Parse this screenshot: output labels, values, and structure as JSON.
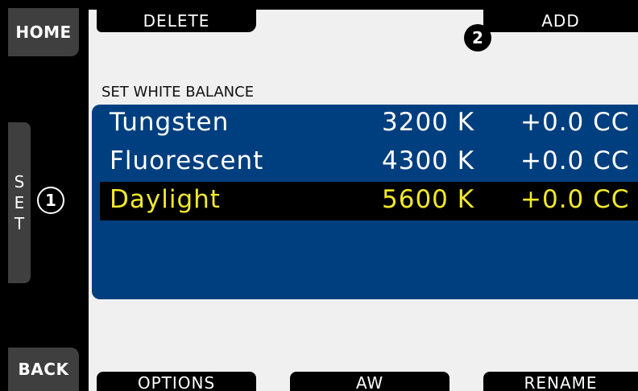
{
  "softkeys": {
    "home": "HOME",
    "back": "BACK",
    "set_letters": [
      "S",
      "E",
      "T"
    ],
    "delete": "DELETE",
    "add": "ADD",
    "options": "OPTIONS",
    "aw": "AW",
    "rename": "RENAME"
  },
  "callouts": {
    "one": "1",
    "two": "2"
  },
  "section_title": "SET WHITE BALANCE",
  "white_balance_list": [
    {
      "name": "Tungsten",
      "temperature": "3200 K",
      "cc": "+0.0 CC",
      "selected": false
    },
    {
      "name": "Fluorescent",
      "temperature": "4300 K",
      "cc": "+0.0 CC",
      "selected": false
    },
    {
      "name": "Daylight",
      "temperature": "5600 K",
      "cc": "+0.0 CC",
      "selected": true
    }
  ],
  "colors": {
    "list_background": "#003f7f",
    "selected_text": "#f2e92a",
    "softkey_gray": "#3f3f3f"
  }
}
